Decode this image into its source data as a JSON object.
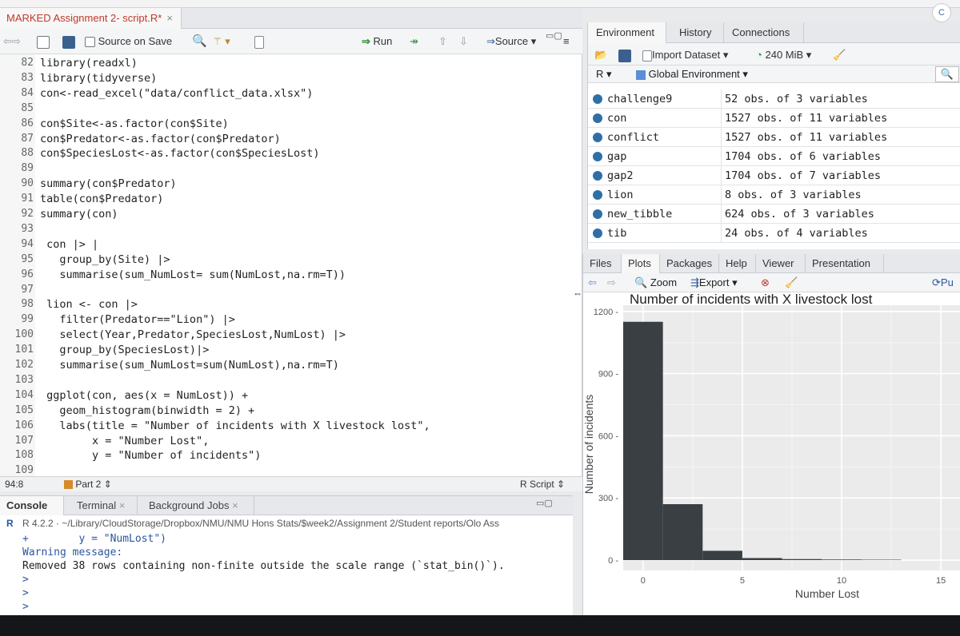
{
  "editor": {
    "tab_label": "MARKED Assignment 2- script.R*",
    "tab_close": "×",
    "source_on_save": "Source on Save",
    "run": "Run",
    "source": "Source",
    "status_pos": "94:8",
    "status_part": "Part 2",
    "status_type": "R Script",
    "lines": [
      {
        "n": "82",
        "t": "library(readxl)"
      },
      {
        "n": "83",
        "t": "library(tidyverse)"
      },
      {
        "n": "84",
        "t": "con<-read_excel(\"data/conflict_data.xlsx\")"
      },
      {
        "n": "85",
        "t": ""
      },
      {
        "n": "86",
        "t": "con$Site<-as.factor(con$Site)"
      },
      {
        "n": "87",
        "t": "con$Predator<-as.factor(con$Predator)"
      },
      {
        "n": "88",
        "t": "con$SpeciesLost<-as.factor(con$SpeciesLost)"
      },
      {
        "n": "89",
        "t": ""
      },
      {
        "n": "90",
        "t": "summary(con$Predator)"
      },
      {
        "n": "91",
        "t": "table(con$Predator)"
      },
      {
        "n": "92",
        "t": "summary(con)"
      },
      {
        "n": "93",
        "t": ""
      },
      {
        "n": "94",
        "t": " con |> |"
      },
      {
        "n": "95",
        "t": "   group_by(Site) |>"
      },
      {
        "n": "96",
        "t": "   summarise(sum_NumLost= sum(NumLost,na.rm=T))"
      },
      {
        "n": "97",
        "t": ""
      },
      {
        "n": "98",
        "t": " lion <- con |>"
      },
      {
        "n": "99",
        "t": "   filter(Predator==\"Lion\") |>"
      },
      {
        "n": "100",
        "t": "   select(Year,Predator,SpeciesLost,NumLost) |>"
      },
      {
        "n": "101",
        "t": "   group_by(SpeciesLost)|>"
      },
      {
        "n": "102",
        "t": "   summarise(sum_NumLost=sum(NumLost),na.rm=T)"
      },
      {
        "n": "103",
        "t": ""
      },
      {
        "n": "104",
        "t": " ggplot(con, aes(x = NumLost)) +"
      },
      {
        "n": "105",
        "t": "   geom_histogram(binwidth = 2) +"
      },
      {
        "n": "106",
        "t": "   labs(title = \"Number of incidents with X livestock lost\","
      },
      {
        "n": "107",
        "t": "        x = \"Number Lost\","
      },
      {
        "n": "108",
        "t": "        y = \"Number of incidents\")"
      },
      {
        "n": "109",
        "t": ""
      }
    ]
  },
  "console": {
    "tabs": [
      "Console",
      "Terminal",
      "Background Jobs"
    ],
    "r_version": "R 4.2.2",
    "path": "~/Library/CloudStorage/Dropbox/NMU/NMU Hons Stats/$week2/Assignment 2/Student reports/Olo Ass",
    "lines": [
      {
        "t": "+        y = \"NumLost\")",
        "c": "#2a56a0"
      },
      {
        "t": "Warning message:",
        "c": "#2a56a0"
      },
      {
        "t": "Removed 38 rows containing non-finite outside the scale range (`stat_bin()`).",
        "c": "#222"
      },
      {
        "t": ">",
        "c": "#2a56a0"
      },
      {
        "t": ">",
        "c": "#2a56a0"
      },
      {
        "t": ">",
        "c": "#2a56a0"
      }
    ]
  },
  "env": {
    "tabs": [
      "Environment",
      "History",
      "Connections"
    ],
    "import_dataset": "Import Dataset",
    "memory": "240 MiB",
    "scope_lang": "R",
    "scope": "Global Environment",
    "vars": [
      {
        "name": "challenge9",
        "value": "52 obs. of 3 variables"
      },
      {
        "name": "con",
        "value": "1527 obs. of 11 variables"
      },
      {
        "name": "conflict",
        "value": "1527 obs. of 11 variables"
      },
      {
        "name": "gap",
        "value": "1704 obs. of 6 variables"
      },
      {
        "name": "gap2",
        "value": "1704 obs. of 7 variables"
      },
      {
        "name": "lion",
        "value": "8 obs. of 3 variables"
      },
      {
        "name": "new_tibble",
        "value": "624 obs. of 3 variables"
      },
      {
        "name": "tib",
        "value": "24 obs. of 4 variables"
      }
    ]
  },
  "plots": {
    "tabs": [
      "Files",
      "Plots",
      "Packages",
      "Help",
      "Viewer",
      "Presentation"
    ],
    "zoom": "Zoom",
    "export": "Export",
    "publish": "Pu"
  },
  "chart_data": {
    "type": "bar",
    "title": "Number of incidents with X livestock lost",
    "xlabel": "Number Lost",
    "ylabel": "Number of incidents",
    "bins": [
      {
        "from": -1,
        "to": 1,
        "count": 1150
      },
      {
        "from": 1,
        "to": 3,
        "count": 270
      },
      {
        "from": 3,
        "to": 5,
        "count": 45
      },
      {
        "from": 5,
        "to": 7,
        "count": 10
      },
      {
        "from": 7,
        "to": 9,
        "count": 5
      },
      {
        "from": 9,
        "to": 11,
        "count": 3
      },
      {
        "from": 11,
        "to": 13,
        "count": 2
      }
    ],
    "xlim": [
      -1,
      16
    ],
    "ylim": [
      -50,
      1230
    ],
    "xticks": [
      0,
      5,
      10,
      15
    ],
    "yticks": [
      0,
      300,
      600,
      900,
      1200
    ],
    "colors": {
      "bar": "#3a3f44",
      "panel": "#ebebeb",
      "grid": "#ffffff"
    }
  }
}
